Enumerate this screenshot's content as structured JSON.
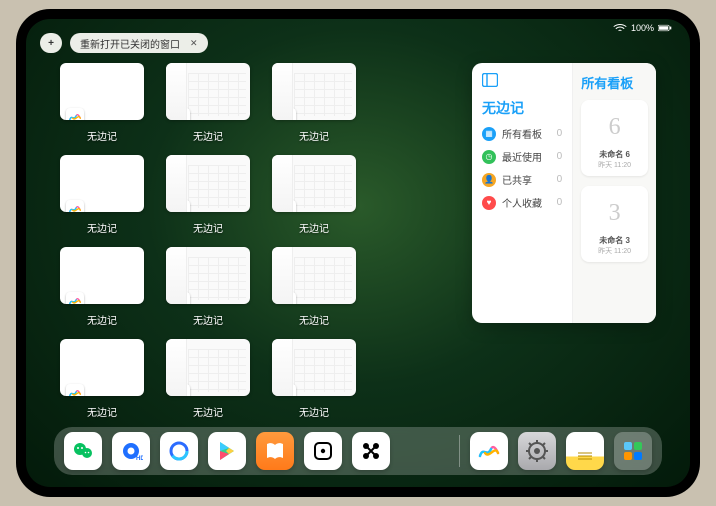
{
  "statusbar": {
    "battery": "100%"
  },
  "topbar": {
    "tab_label": "重新打开已关闭的窗口"
  },
  "app_name": "无边记",
  "windows": [
    {
      "label": "无边记",
      "style": "blank"
    },
    {
      "label": "无边记",
      "style": "cal"
    },
    {
      "label": "无边记",
      "style": "cal"
    },
    {
      "label": "无边记",
      "style": "blank"
    },
    {
      "label": "无边记",
      "style": "cal"
    },
    {
      "label": "无边记",
      "style": "cal"
    },
    {
      "label": "无边记",
      "style": "blank"
    },
    {
      "label": "无边记",
      "style": "cal"
    },
    {
      "label": "无边记",
      "style": "cal"
    },
    {
      "label": "无边记",
      "style": "blank"
    },
    {
      "label": "无边记",
      "style": "cal"
    },
    {
      "label": "无边记",
      "style": "cal"
    }
  ],
  "sidebar": {
    "title": "无边记",
    "items": [
      {
        "icon": "all",
        "color": "#1aa0f8",
        "label": "所有看板",
        "count": "0"
      },
      {
        "icon": "clock",
        "color": "#32c15a",
        "label": "最近使用",
        "count": "0"
      },
      {
        "icon": "share",
        "color": "#f6a623",
        "label": "已共享",
        "count": "0"
      },
      {
        "icon": "heart",
        "color": "#ff4b4b",
        "label": "个人收藏",
        "count": "0"
      }
    ]
  },
  "right_panel": {
    "title": "所有看板",
    "boards": [
      {
        "glyph": "6",
        "name": "未命名 6",
        "date": "昨天 11:20"
      },
      {
        "glyph": "3",
        "name": "未命名 3",
        "date": "昨天 11:20"
      }
    ]
  },
  "dock": {
    "main": [
      {
        "name": "wechat",
        "bg": "#fff"
      },
      {
        "name": "tencent-video",
        "bg": "#fff"
      },
      {
        "name": "quark",
        "bg": "#fff"
      },
      {
        "name": "playstore",
        "bg": "#fff"
      },
      {
        "name": "books",
        "bg": "linear-gradient(#ff9a3d,#ff7a1a)"
      },
      {
        "name": "dice",
        "bg": "#fff"
      },
      {
        "name": "puzzle",
        "bg": "#fff"
      }
    ],
    "recent": [
      {
        "name": "freeform",
        "bg": "#fff"
      },
      {
        "name": "settings",
        "bg": "linear-gradient(#d7d7d9,#a9a9ad)"
      },
      {
        "name": "notes",
        "bg": "linear-gradient(#fff 65%,#ffd84a 65%)"
      },
      {
        "name": "app-library",
        "bg": "rgba(255,255,255,.25)"
      }
    ]
  }
}
